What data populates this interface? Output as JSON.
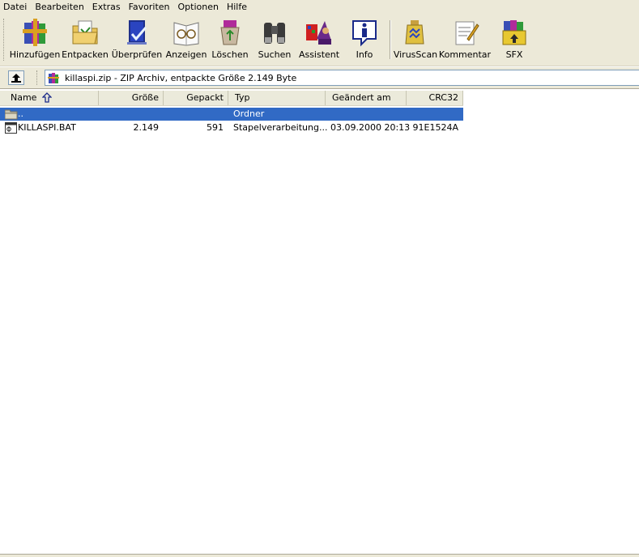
{
  "menu": [
    "Datei",
    "Bearbeiten",
    "Extras",
    "Favoriten",
    "Optionen",
    "Hilfe"
  ],
  "toolbar": [
    {
      "label": "Hinzufügen",
      "icon": "add-books-icon"
    },
    {
      "label": "Entpacken",
      "icon": "extract-folder-icon"
    },
    {
      "label": "Überprüfen",
      "icon": "test-check-icon"
    },
    {
      "label": "Anzeigen",
      "icon": "view-glasses-icon"
    },
    {
      "label": "Löschen",
      "icon": "delete-recycle-icon"
    },
    {
      "label": "Suchen",
      "icon": "find-binoculars-icon"
    },
    {
      "label": "Assistent",
      "icon": "wizard-icon"
    },
    {
      "label": "Info",
      "icon": "info-icon"
    },
    {
      "label": "VirusScan",
      "icon": "virusscan-icon"
    },
    {
      "label": "Kommentar",
      "icon": "comment-icon"
    },
    {
      "label": "SFX",
      "icon": "sfx-box-icon"
    }
  ],
  "address": {
    "text": "killaspi.zip - ZIP Archiv, entpackte Größe 2.149 Byte"
  },
  "columns": {
    "name": "Name",
    "size": "Größe",
    "packed": "Gepackt",
    "type": "Typ",
    "modified": "Geändert am",
    "crc": "CRC32"
  },
  "rows": [
    {
      "name": "..",
      "size": "",
      "packed": "",
      "type": "Ordner",
      "modified": "",
      "crc": "",
      "selected": true
    },
    {
      "name": "KILLASPI.BAT",
      "size": "2.149",
      "packed": "591",
      "type": "Stapelverarbeitung...",
      "modified": "03.09.2000 20:13",
      "crc": "91E1524A",
      "selected": false
    }
  ],
  "colors": {
    "selection": "#316ac5",
    "chrome": "#ece9d8"
  }
}
